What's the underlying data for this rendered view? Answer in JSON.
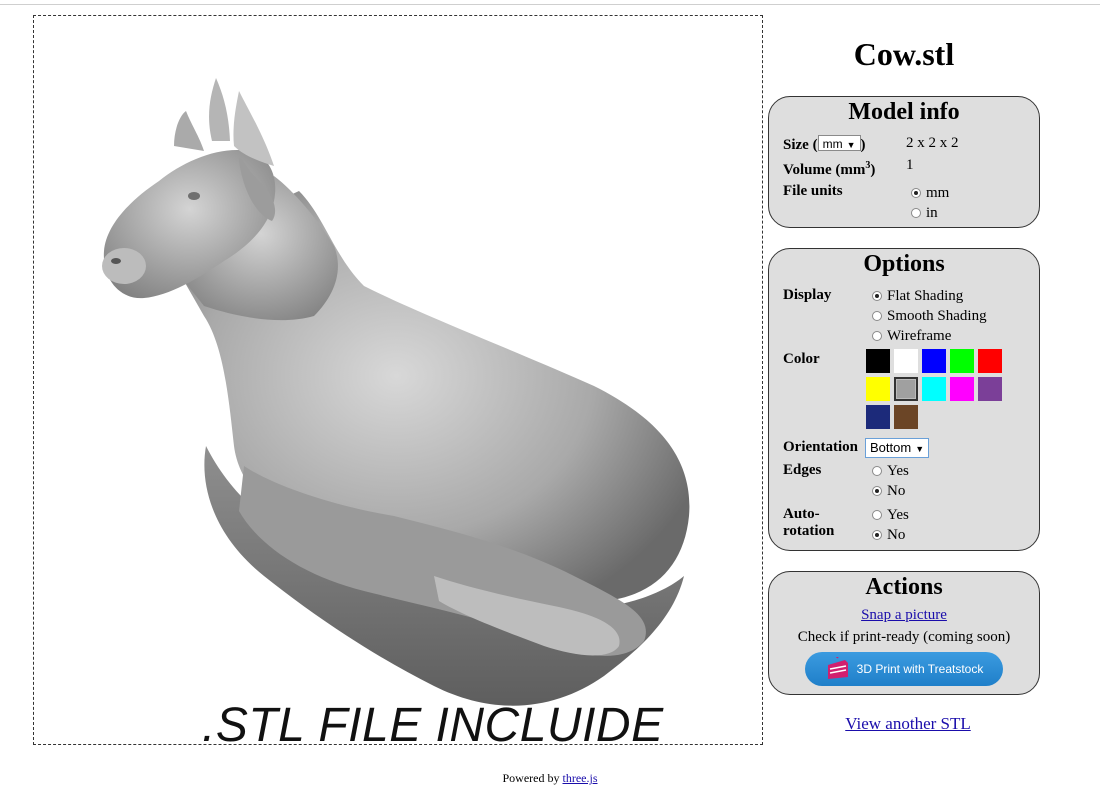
{
  "viewer": {
    "overlay_text": ".STL FILE INCLUIDE"
  },
  "file_title": "Cow.stl",
  "model_info": {
    "heading": "Model info",
    "size_label": "Size (",
    "size_close": ")",
    "size_unit_selected": "mm",
    "size_value": "2 x 2 x 2",
    "volume_label": "Volume (mm",
    "volume_sup": "3",
    "volume_close": ")",
    "volume_value": "1",
    "file_units_label": "File units",
    "file_units_options": [
      "mm",
      "in"
    ],
    "file_units_selected": "mm"
  },
  "options": {
    "heading": "Options",
    "display_label": "Display",
    "display_options": [
      "Flat Shading",
      "Smooth Shading",
      "Wireframe"
    ],
    "display_selected": "Flat Shading",
    "color_label": "Color",
    "colors": [
      "#000000",
      "#ffffff",
      "#0000ff",
      "#00ff00",
      "#ff0000",
      "#ffff00",
      "#a0a0a0",
      "#00ffff",
      "#ff00ff",
      "#7b3f98",
      "#1c2a7a",
      "#6b4526"
    ],
    "color_selected": "#a0a0a0",
    "orientation_label": "Orientation",
    "orientation_selected": "Bottom",
    "edges_label": "Edges",
    "edges_options": [
      "Yes",
      "No"
    ],
    "edges_selected": "No",
    "autorotation_label_1": "Auto-",
    "autorotation_label_2": "rotation",
    "autorotation_options": [
      "Yes",
      "No"
    ],
    "autorotation_selected": "No"
  },
  "actions": {
    "heading": "Actions",
    "snap_label": "Snap a picture",
    "print_ready_text": "Check if print-ready (coming soon)",
    "print_button_label": "3D Print with Treatstock",
    "print_button_icon": "cake-icon"
  },
  "view_another_label": "View another STL",
  "footer": {
    "prefix": "Powered by ",
    "link": "three.js"
  }
}
